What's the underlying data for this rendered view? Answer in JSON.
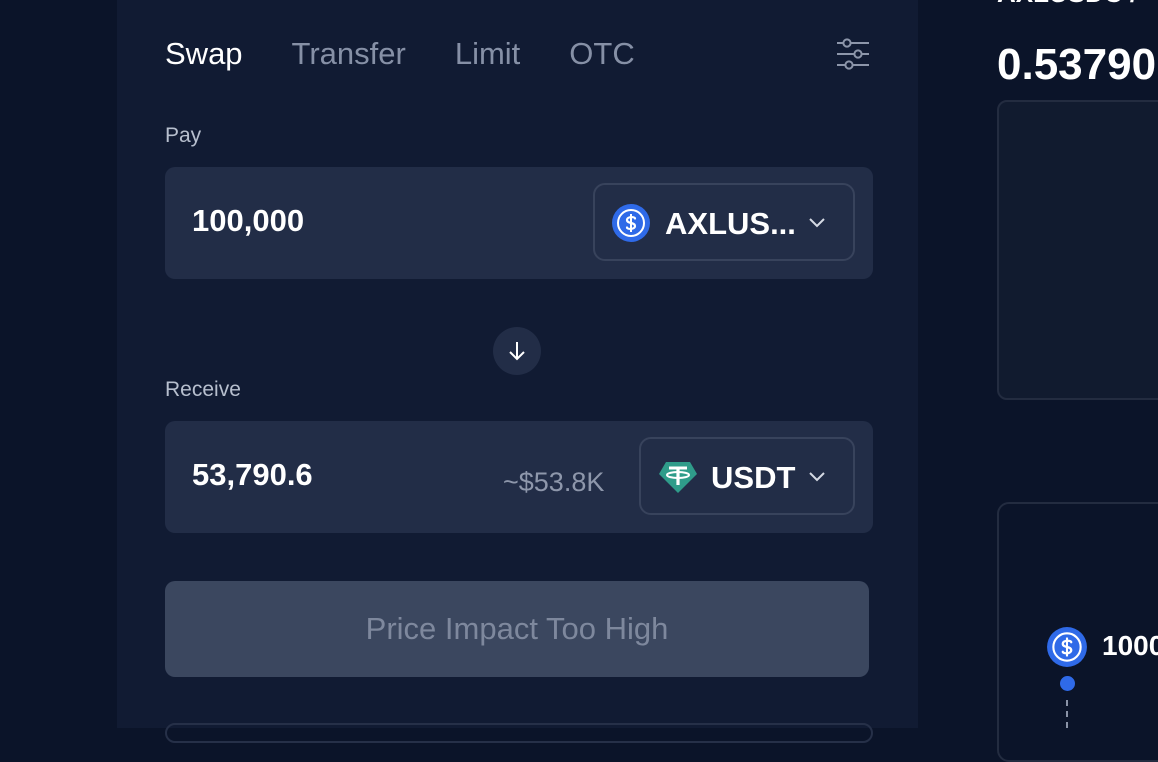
{
  "tabs": [
    {
      "label": "Swap",
      "active": true
    },
    {
      "label": "Transfer",
      "active": false
    },
    {
      "label": "Limit",
      "active": false
    },
    {
      "label": "OTC",
      "active": false
    }
  ],
  "settings_icon": "sliders-icon",
  "pay": {
    "label": "Pay",
    "amount": "100,000",
    "token": "AXLUS...",
    "token_icon": "usdc-icon"
  },
  "receive": {
    "label": "Receive",
    "amount": "53,790.6",
    "usd_value": "~$53.8K",
    "token": "USDT",
    "token_icon": "tether-icon"
  },
  "switch_icon": "arrow-down-icon",
  "action_button": {
    "label": "Price Impact Too High",
    "disabled": true
  },
  "right_panel": {
    "pair_label": "AXLUSDC /",
    "price": "0.53790",
    "route_amount": "1000"
  },
  "colors": {
    "background": "#0b1429",
    "panel": "#111b33",
    "card": "#222d47",
    "usdc_blue": "#2f6ae8",
    "tether_green": "#2f9c8a",
    "disabled_button": "#3b475f"
  }
}
